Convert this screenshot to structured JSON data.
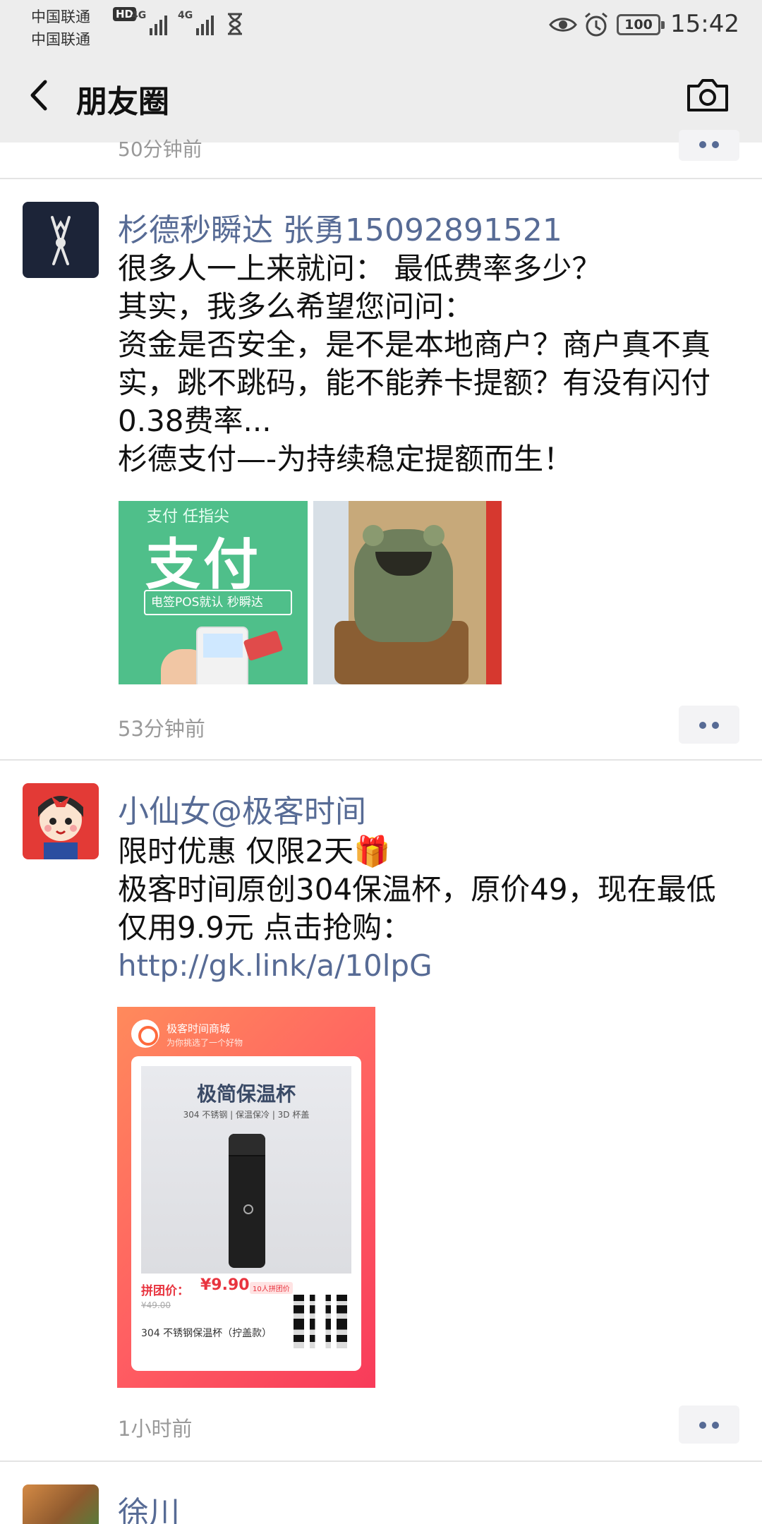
{
  "status_bar": {
    "carrier_1": "中国联通",
    "carrier_2": "中国联通",
    "hd_badge": "HD",
    "network_1": "4G",
    "network_2": "4G",
    "battery": "100",
    "time": "15:42"
  },
  "nav": {
    "title": "朋友圈"
  },
  "previous_post": {
    "time": "50分钟前"
  },
  "posts": [
    {
      "author": "杉德秒瞬达   张勇15092891521",
      "text": "很多人一上来就问： 最低费率多少？\n其实，我多么希望您问问：\n资金是否安全，是不是本地商户？商户真不真实，跳不跳码，能不能养卡提额？有没有闪付0.38费率...\n杉德支付—-为持续稳定提额而生！",
      "images": [
        {
          "top_text": "支付 任指尖",
          "big_text": "支付",
          "band_text": "电签POS就认 秒瞬达"
        },
        {
          "desc": "toad"
        }
      ],
      "time": "53分钟前"
    },
    {
      "author": "小仙女@极客时间",
      "text_line1": "限时优惠 仅限2天🎁",
      "text_line2": "极客时间原创304保温杯，原价49，现在最低仅用9.9元 点击抢购：",
      "link": "http://gk.link/a/10lpG",
      "card": {
        "store": "极客时间商城",
        "store_sub": "为你挑选了一个好物",
        "product_title": "极简保温杯",
        "product_spec": "304 不锈钢 | 保温保冷 | 3D 杯盖",
        "price_label": "拼团价：",
        "price": "¥9.90",
        "badge": "10人拼团价",
        "old_price": "¥49.00",
        "name": "304 不锈钢保温杯（拧盖款）"
      },
      "time": "1小时前"
    },
    {
      "author": "徐川"
    }
  ]
}
